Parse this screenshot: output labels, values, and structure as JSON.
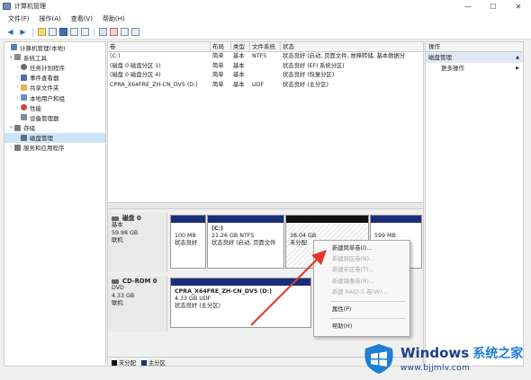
{
  "window": {
    "title": "计算机管理",
    "minimize": "—",
    "maximize": "☐",
    "close": "✕"
  },
  "menubar": [
    "文件(F)",
    "操作(A)",
    "查看(V)",
    "帮助(H)"
  ],
  "tree": {
    "items": [
      {
        "label": "计算机管理(本地)",
        "caret": "",
        "icon_color": "#5b7fb0"
      },
      {
        "label": "系统工具",
        "caret": "∨",
        "icon_color": "#8a8a8a"
      },
      {
        "label": "任务计划程序",
        "caret": "›",
        "icon_color": "#6a6a6a"
      },
      {
        "label": "事件查看器",
        "caret": "›",
        "icon_color": "#4c6ea6"
      },
      {
        "label": "共享文件夹",
        "caret": "›",
        "icon_color": "#e0b64a"
      },
      {
        "label": "本地用户和组",
        "caret": "›",
        "icon_color": "#6f8fb6"
      },
      {
        "label": "性能",
        "caret": "›",
        "icon_color": "#c64a3a"
      },
      {
        "label": "设备管理器",
        "caret": "",
        "icon_color": "#7a8aa0"
      },
      {
        "label": "存储",
        "caret": "∨",
        "icon_color": "#7a7a7a"
      },
      {
        "label": "磁盘管理",
        "caret": "",
        "icon_color": "#5a6f8c"
      },
      {
        "label": "服务和应用程序",
        "caret": "›",
        "icon_color": "#7a7a7a"
      }
    ]
  },
  "volumes": {
    "headers": [
      "卷",
      "布局",
      "类型",
      "文件系统",
      "状态"
    ],
    "rows": [
      [
        "(C:)",
        "简单",
        "基本",
        "NTFS",
        "状态良好 (启动, 页面文件, 故障转储, 基本数据分"
      ],
      [
        "(磁盘 0 磁盘分区 1)",
        "简单",
        "基本",
        "",
        "状态良好 (EFI 系统分区)"
      ],
      [
        "(磁盘 0 磁盘分区 4)",
        "简单",
        "基本",
        "",
        "状态良好 (恢复分区)"
      ],
      [
        "CPRA_X64FRE_ZH-CN_DV5 (D:)",
        "简单",
        "基本",
        "UDF",
        "状态良好 (主分区)"
      ]
    ]
  },
  "disks": {
    "disk0": {
      "name": "磁盘 0",
      "lines": [
        "基本",
        "59.98 GB",
        "联机"
      ],
      "partitions": [
        {
          "l1": "",
          "l2": "100 MB",
          "l3": "状态良好"
        },
        {
          "l1": "(C:)",
          "l2": "21.26 GB NTFS",
          "l3": "状态良好 (启动, 页面文件"
        },
        {
          "l1": "",
          "l2": "38.04 GB",
          "l3": "未分配"
        },
        {
          "l1": "",
          "l2": "599 MB",
          "l3": ""
        }
      ]
    },
    "cdrom0": {
      "name": "CD-ROM 0",
      "lines": [
        "DVD",
        "4.33 GB",
        "联机"
      ],
      "partition": {
        "l1": "CPRA_X64FRE_ZH-CN_DV5 (D:)",
        "l2": "4.33 GB UDF",
        "l3": "状态良好 (主分区)"
      }
    }
  },
  "legend": [
    {
      "label": "未分配",
      "color": "#111111"
    },
    {
      "label": "主分区",
      "color": "#1b2e7a"
    }
  ],
  "actions": {
    "header": "操作",
    "section": "磁盘管理",
    "more": "更多操作"
  },
  "context_menu": {
    "items": [
      {
        "label": "新建简单卷(I)...",
        "enabled": true
      },
      {
        "label": "新建跨区卷(N)...",
        "enabled": false
      },
      {
        "label": "新建带区卷(T)...",
        "enabled": false
      },
      {
        "label": "新建镜像卷(R)...",
        "enabled": false
      },
      {
        "label": "新建 RAID-5 卷(W)...",
        "enabled": false
      },
      {
        "label": "属性(P)",
        "enabled": true
      },
      {
        "label": "帮助(H)",
        "enabled": true
      }
    ]
  },
  "arrow_color": "#e0382a",
  "watermark": {
    "title": "Windows",
    "title_cn": "系统之家",
    "url": "www.bjjmlv.com"
  }
}
